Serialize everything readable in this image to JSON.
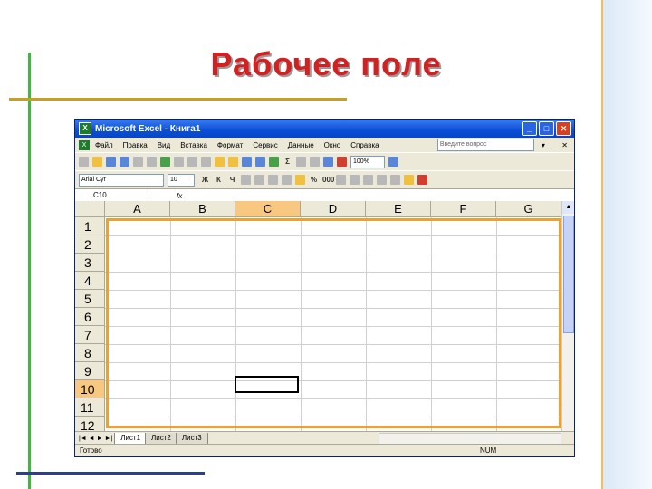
{
  "slide": {
    "title": "Рабочее поле"
  },
  "window": {
    "title": "Microsoft Excel - Книга1",
    "icon": "excel-icon",
    "controls": {
      "minimize": "_",
      "maximize": "□",
      "close": "✕"
    }
  },
  "menu": {
    "items": [
      "Файл",
      "Правка",
      "Вид",
      "Вставка",
      "Формат",
      "Сервис",
      "Данные",
      "Окно",
      "Справка"
    ],
    "help_placeholder": "Введите вопрос",
    "doc_controls": [
      "▾",
      "_",
      "✕"
    ]
  },
  "toolbar": {
    "zoom": "100%"
  },
  "format_toolbar": {
    "font": "Arial Cyr",
    "size": "10",
    "bold": "Ж",
    "italic": "К",
    "underline": "Ч",
    "percent": "%",
    "thousands": "000"
  },
  "formula_bar": {
    "name_box": "C10",
    "fx": "fx"
  },
  "sheet": {
    "columns": [
      "A",
      "B",
      "C",
      "D",
      "E",
      "F",
      "G"
    ],
    "rows": [
      "1",
      "2",
      "3",
      "4",
      "5",
      "6",
      "7",
      "8",
      "9",
      "10",
      "11",
      "12"
    ],
    "selected_column": "C",
    "selected_row": "10",
    "active_cell": "C10"
  },
  "tabs": {
    "nav": "|◄ ◄ ► ►|",
    "sheets": [
      "Лист1",
      "Лист2",
      "Лист3"
    ],
    "active": "Лист1"
  },
  "status": {
    "text": "Готово",
    "num": "NUM"
  },
  "colors": {
    "title_red": "#d42020",
    "frame_orange": "#f0a030",
    "titlebar_blue": "#0a4ed8",
    "selection": "#f8c880"
  }
}
